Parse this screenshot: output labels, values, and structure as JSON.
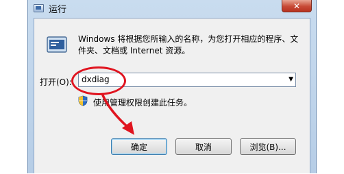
{
  "window": {
    "title": "运行",
    "close_label": "✕"
  },
  "dialog": {
    "description": "Windows 将根据您所输入的名称，为您打开相应的程序、文件夹、文档或 Internet 资源。",
    "open_label": "打开(O):",
    "open_value": "dxdiag",
    "admin_note": "使用管理权限创建此任务。"
  },
  "buttons": {
    "ok": "确定",
    "cancel": "取消",
    "browse": "浏览(B)..."
  },
  "icons": {
    "title": "run-dialog-icon",
    "dialog": "run-program-icon",
    "shield": "uac-shield-icon",
    "dropdown": "chevron-down-icon"
  },
  "colors": {
    "highlight": "#e0141f",
    "titlebar": "#c9dcef",
    "close": "#c74a36"
  }
}
